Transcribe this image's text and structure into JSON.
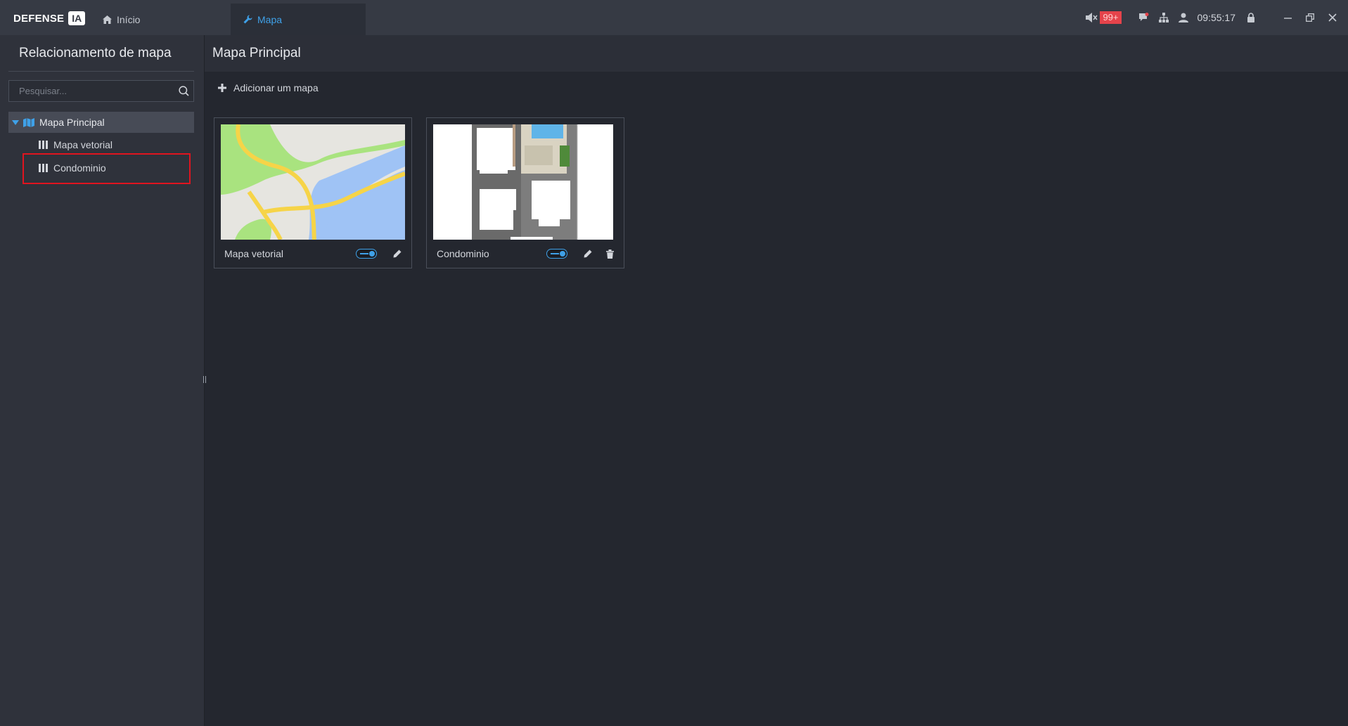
{
  "app": {
    "logo_text": "DEFENSE",
    "logo_badge": "IA"
  },
  "nav": {
    "home_label": "Início",
    "active_label": "Mapa"
  },
  "status": {
    "alarm_count": "99+",
    "time": "09:55:17"
  },
  "sidebar": {
    "title": "Relacionamento de mapa",
    "search_placeholder": "Pesquisar...",
    "tree": {
      "root_label": "Mapa Principal",
      "children": [
        {
          "label": "Mapa vetorial"
        },
        {
          "label": "Condominio"
        }
      ]
    }
  },
  "main": {
    "title": "Mapa Principal",
    "add_map_label": "Adicionar um mapa",
    "cards": [
      {
        "name": "Mapa vetorial",
        "enabled": true
      },
      {
        "name": "Condominio",
        "enabled": true
      }
    ]
  },
  "colors": {
    "accent": "#3fa1e8",
    "highlight": "#e0141f",
    "alarm": "#e5434b"
  }
}
